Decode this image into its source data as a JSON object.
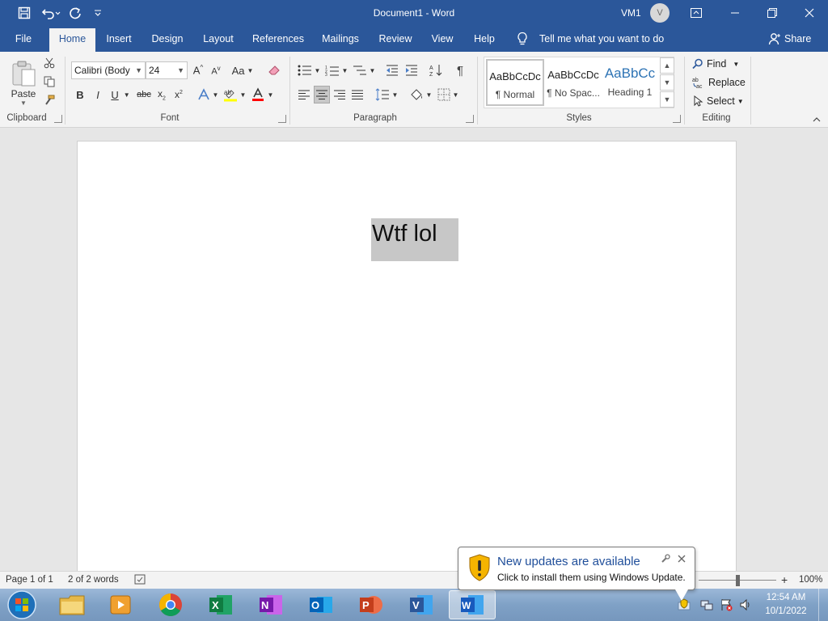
{
  "window": {
    "title": "Document1 - Word",
    "user_name": "VM1",
    "avatar_initial": "V"
  },
  "tabs": [
    "File",
    "Home",
    "Insert",
    "Design",
    "Layout",
    "References",
    "Mailings",
    "Review",
    "View",
    "Help"
  ],
  "active_tab": "Home",
  "tell_me": "Tell me what you want to do",
  "share_label": "Share",
  "clipboard": {
    "paste_label": "Paste",
    "group_label": "Clipboard"
  },
  "font": {
    "name": "Calibri (Body",
    "size": "24",
    "group_label": "Font",
    "case_label": "Aa"
  },
  "paragraph": {
    "group_label": "Paragraph"
  },
  "styles": {
    "group_label": "Styles",
    "items": [
      {
        "preview": "AaBbCcDc",
        "name": "¶ Normal"
      },
      {
        "preview": "AaBbCcDc",
        "name": "¶ No Spac..."
      },
      {
        "preview": "AaBbCc",
        "name": "Heading 1"
      }
    ]
  },
  "editing": {
    "find_label": "Find",
    "replace_label": "Replace",
    "select_label": "Select",
    "group_label": "Editing"
  },
  "document": {
    "text": "Wtf lol"
  },
  "status": {
    "page": "Page 1 of 1",
    "words": "2 of 2 words",
    "zoom": "100%"
  },
  "notification": {
    "title": "New updates are available",
    "body": "Click to install them using Windows Update."
  },
  "clock": {
    "time": "12:54 AM",
    "date": "10/1/2022"
  },
  "colors": {
    "word_blue": "#2b579a",
    "highlight": "#ffff00",
    "font_color": "#ff0000"
  }
}
